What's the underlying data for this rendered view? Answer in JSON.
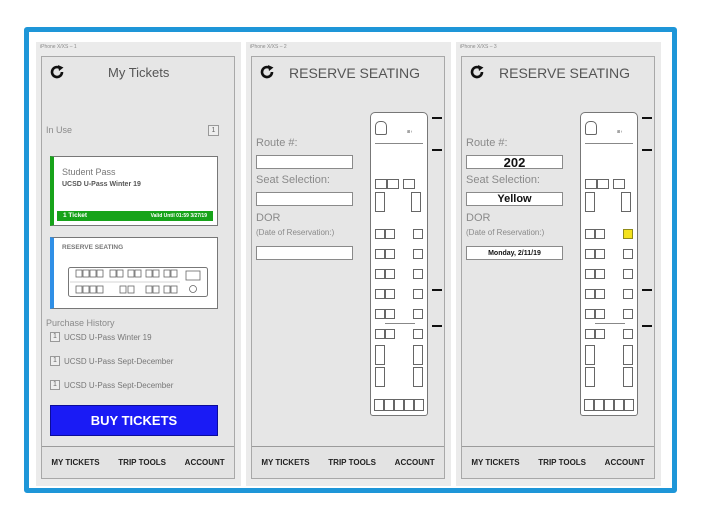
{
  "screens": [
    {
      "artboard_label": "iPhone X/XS – 1",
      "title": "My Tickets",
      "in_use_label": "In Use",
      "in_use_count": "1",
      "pass_card": {
        "title": "Student Pass",
        "subtitle": "UCSD U-Pass Winter 19",
        "ticket_count": "1 Ticket",
        "valid_until": "Valid Until 01:59 3/27/19"
      },
      "reserve_card": {
        "title": "RESERVE SEATING"
      },
      "purchase_history_label": "Purchase History",
      "history": [
        {
          "count": "1",
          "label": "UCSD U-Pass Winter 19"
        },
        {
          "count": "1",
          "label": "UCSD U-Pass Sept-December"
        },
        {
          "count": "1",
          "label": "UCSD U-Pass Sept-December"
        }
      ],
      "buy_button": "BUY TICKETS"
    },
    {
      "artboard_label": "iPhone X/XS – 2",
      "title": "RESERVE SEATING",
      "route_label": "Route #:",
      "route_value": "",
      "seat_label": "Seat Selection:",
      "seat_value": "",
      "dor_label": "DOR",
      "dor_sub": "(Date of Reservation:)",
      "date_value": ""
    },
    {
      "artboard_label": "iPhone X/XS – 3",
      "title": "RESERVE SEATING",
      "route_label": "Route #:",
      "route_value": "202",
      "seat_label": "Seat Selection:",
      "seat_value": "Yellow",
      "dor_label": "DOR",
      "dor_sub": "(Date of Reservation:)",
      "date_value": "Monday, 2/11/19"
    }
  ],
  "nav": {
    "my_tickets": "MY TICKETS",
    "trip_tools": "TRIP TOOLS",
    "account": "ACCOUNT"
  },
  "colors": {
    "accent_border": "#1e96d8",
    "pass_green": "#17a31a",
    "reserve_blue": "#2f8fe6",
    "buy_blue": "#1a1bf5",
    "selected_seat": "#f4e21c"
  },
  "icons": {
    "refresh": "refresh-icon"
  }
}
